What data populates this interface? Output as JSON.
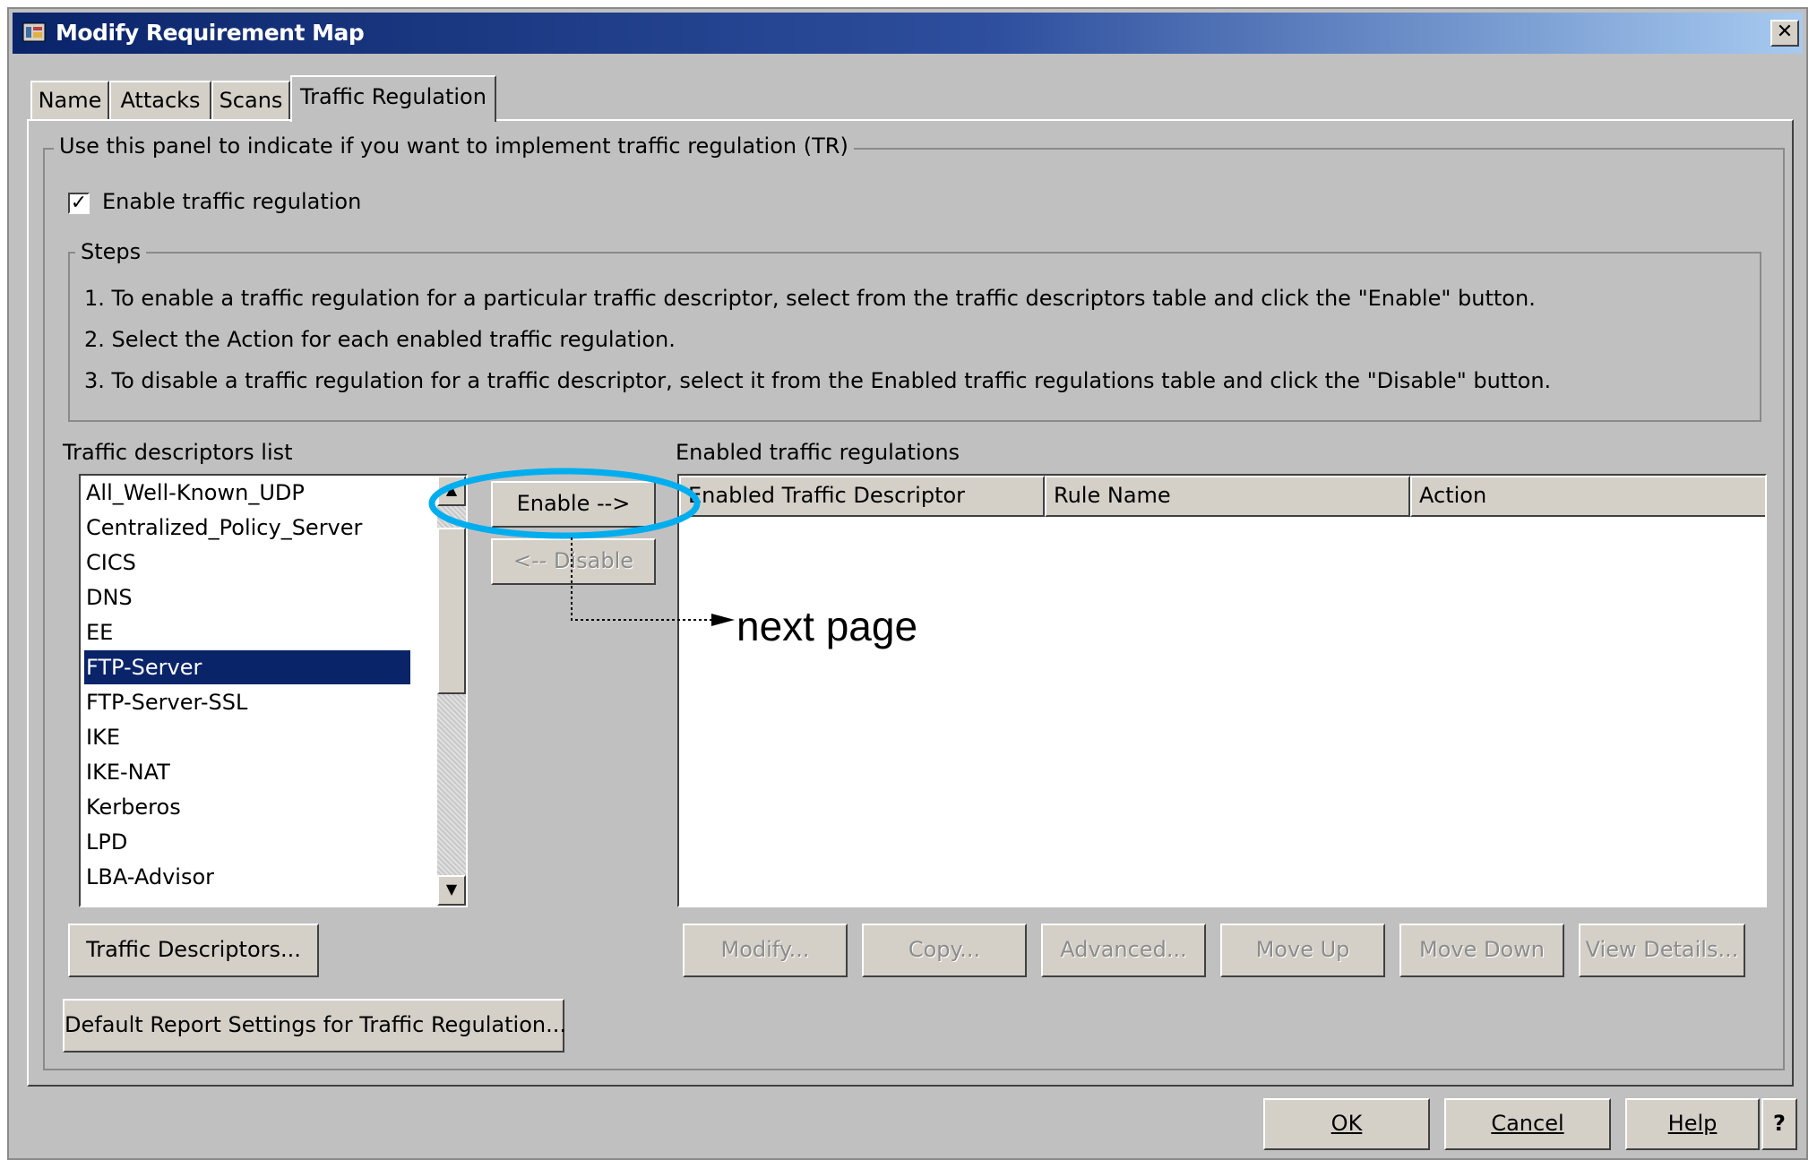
{
  "window": {
    "title": "Modify Requirement Map",
    "close_label": "✕"
  },
  "tabs": [
    {
      "label": "Name"
    },
    {
      "label": "Attacks"
    },
    {
      "label": "Scans"
    },
    {
      "label": "Traffic Regulation",
      "active": true
    }
  ],
  "panel": {
    "group_label": "Use this panel to indicate if you want to implement traffic regulation (TR)",
    "enable_checkbox": {
      "label": "Enable traffic regulation",
      "checked": true,
      "mark": "✓"
    },
    "steps": {
      "label": "Steps",
      "items": [
        "1.  To enable a traffic regulation for a particular traffic descriptor, select from the traffic descriptors table and click the \"Enable\" button.",
        "2.  Select the Action for each enabled traffic regulation.",
        "3.  To disable a traffic regulation for a traffic descriptor, select it from the Enabled traffic regulations table and click the \"Disable\" button."
      ]
    },
    "descriptors": {
      "label": "Traffic descriptors list",
      "items": [
        "All_Well-Known_UDP",
        "Centralized_Policy_Server",
        "CICS",
        "DNS",
        "EE",
        "FTP-Server",
        "FTP-Server-SSL",
        "IKE",
        "IKE-NAT",
        "Kerberos",
        "LPD",
        "LBA-Advisor"
      ],
      "selected": "FTP-Server",
      "scroll_up": "▲",
      "scroll_down": "▼"
    },
    "enable_button": "Enable -->",
    "disable_button": "<-- Disable",
    "enabled_regulations": {
      "label": "Enabled traffic regulations",
      "columns": [
        "Enabled Traffic Descriptor",
        "Rule Name",
        "Action"
      ],
      "rows": []
    },
    "traffic_descriptors_button": "Traffic Descriptors...",
    "default_report_button": "Default Report Settings for Traffic Regulation...",
    "table_buttons": [
      "Modify...",
      "Copy...",
      "Advanced...",
      "Move Up",
      "Move Down",
      "View Details..."
    ]
  },
  "annotation": {
    "text": "next page",
    "highlight_color": "#00aeef"
  },
  "footer": {
    "ok": "OK",
    "cancel": "Cancel",
    "help": "Help",
    "whats_this": "?"
  }
}
